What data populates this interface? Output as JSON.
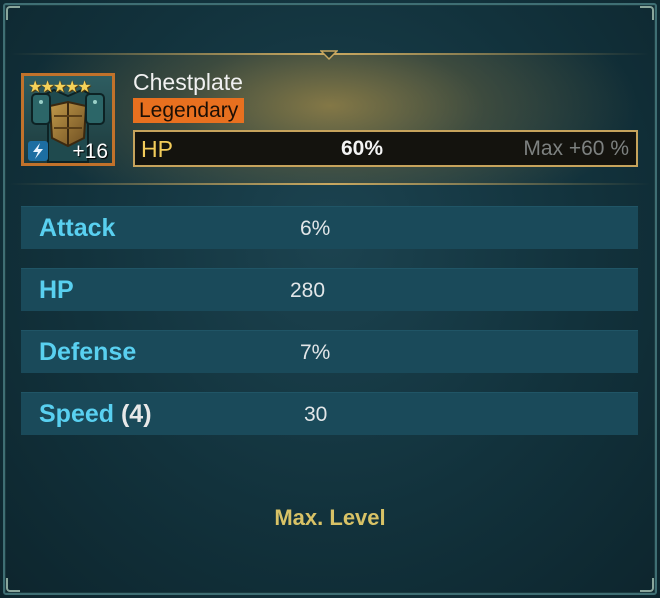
{
  "item": {
    "name": "Chestplate",
    "rarity": "Legendary",
    "stars": "★★★★★",
    "level": "+16",
    "icon": "chestplate-armor-icon",
    "enhance_icon": "enhance-lightning-icon"
  },
  "main_stat": {
    "name": "HP",
    "value": "60%",
    "max": "Max +60 %"
  },
  "substats": [
    {
      "name": "Attack",
      "rolls": "",
      "value": "6%"
    },
    {
      "name": "HP",
      "rolls": "",
      "value": "280"
    },
    {
      "name": "Defense",
      "rolls": "",
      "value": "7%"
    },
    {
      "name": "Speed",
      "rolls": "(4)",
      "value": "30"
    }
  ],
  "footer": {
    "status": "Max. Level"
  },
  "colors": {
    "rarity": "#e8701f",
    "stat_name": "#59d0f0",
    "main_stat_name": "#f3cc5a",
    "footer_text": "#d8c266",
    "border_accent": "#c1722b"
  }
}
